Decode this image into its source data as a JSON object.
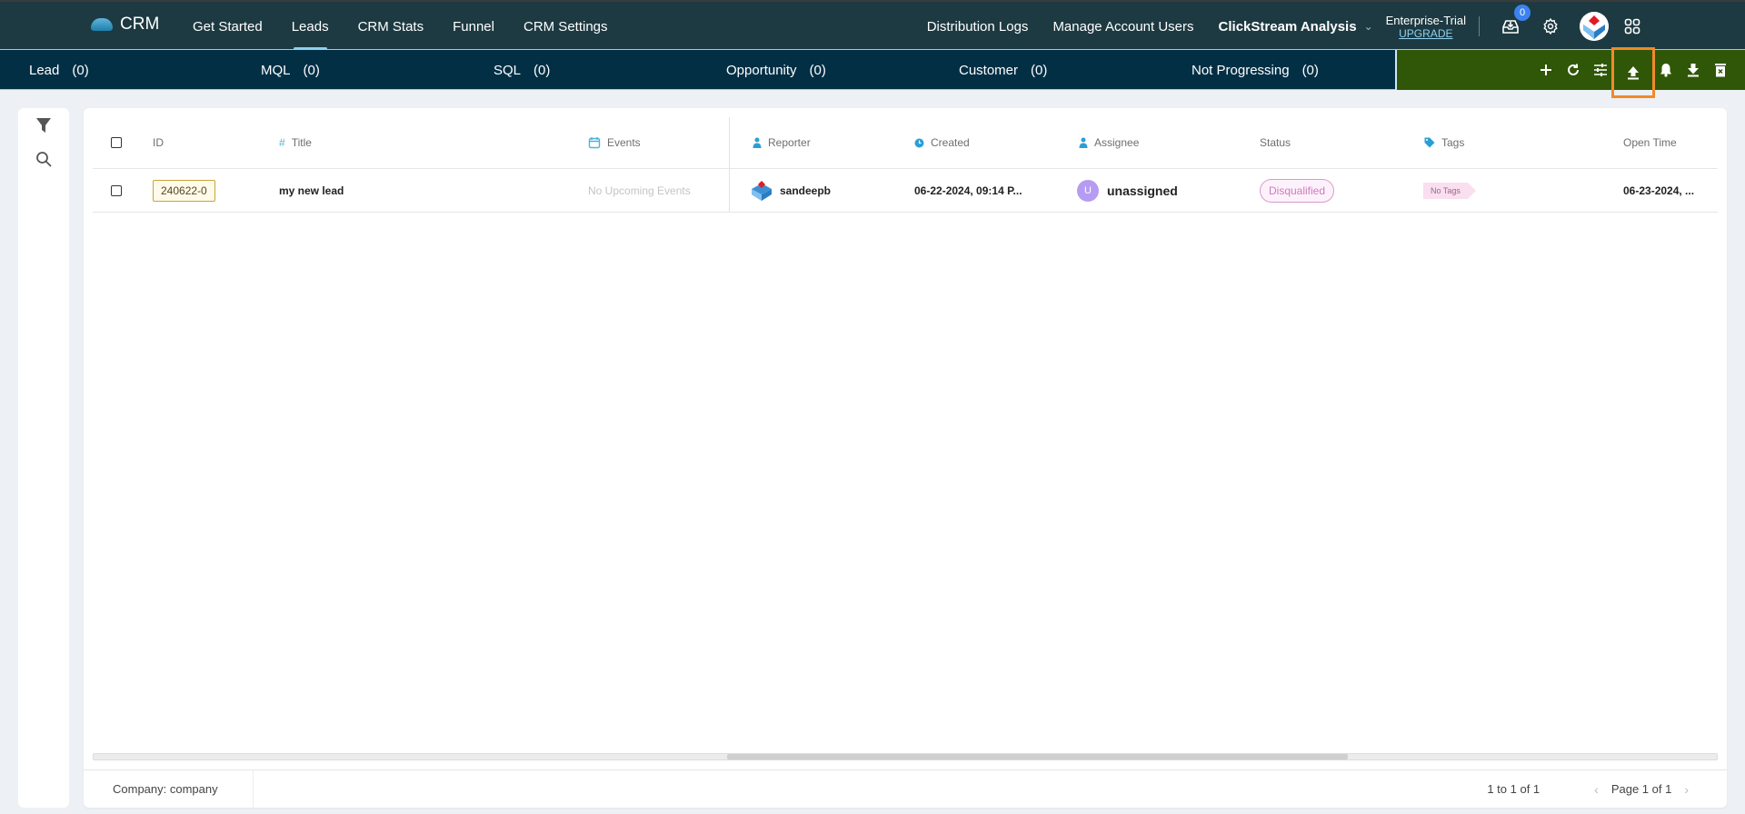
{
  "app": {
    "brand": "CRM",
    "nav": [
      "Get Started",
      "Leads",
      "CRM Stats",
      "Funnel",
      "CRM Settings"
    ],
    "active_nav": "Leads",
    "right_links": [
      "Distribution Logs",
      "Manage Account Users"
    ],
    "workspace": "ClickStream Analysis",
    "plan": "Enterprise-Trial",
    "upgrade": "UPGRADE",
    "notifications_count": "0"
  },
  "stages": [
    {
      "label": "Lead",
      "count": "(0)"
    },
    {
      "label": "MQL",
      "count": "(0)"
    },
    {
      "label": "SQL",
      "count": "(0)"
    },
    {
      "label": "Opportunity",
      "count": "(0)"
    },
    {
      "label": "Customer",
      "count": "(0)"
    },
    {
      "label": "Not Progressing",
      "count": "(0)"
    }
  ],
  "actions": [
    "add-icon",
    "refresh-icon",
    "settings-sliders-icon",
    "upload-icon",
    "bell-icon",
    "download-icon",
    "delete-icon"
  ],
  "highlighted_action": "upload-icon",
  "table": {
    "columns": [
      "ID",
      "Title",
      "Events",
      "Reporter",
      "Created",
      "Assignee",
      "Status",
      "Tags",
      "Open Time"
    ],
    "rows": [
      {
        "id": "240622-0",
        "title": "my new lead",
        "events": "No Upcoming Events",
        "reporter": "sandeepb",
        "created": "06-22-2024, 09:14 P...",
        "assignee_initial": "U",
        "assignee": "unassigned",
        "status": "Disqualified",
        "tags": "No Tags",
        "open_time": "06-23-2024, ..."
      }
    ]
  },
  "footer": {
    "company": "Company: company",
    "range": "1 to 1 of 1",
    "page": "Page 1 of 1"
  },
  "colors": {
    "topbar": "#1d3a42",
    "stagebar": "#032f45",
    "actionbar": "#2f5707",
    "highlight": "#f08a2a",
    "status_disqualified": "#d07ac0"
  }
}
